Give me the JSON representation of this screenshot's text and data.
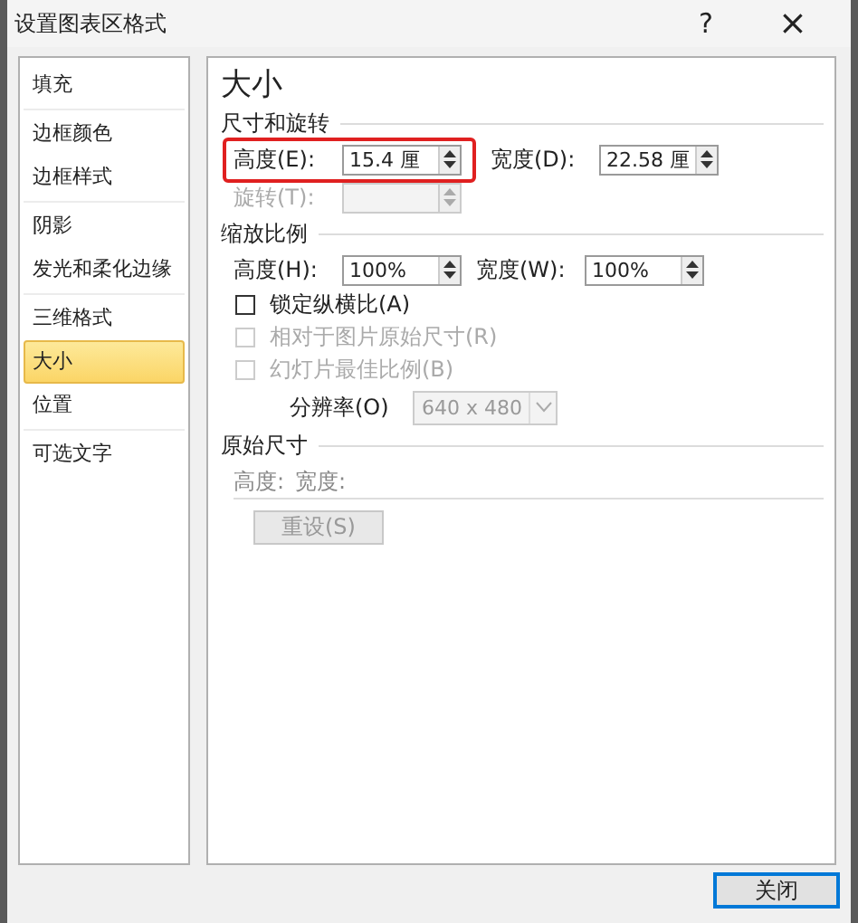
{
  "window": {
    "title": "设置图表区格式",
    "help": "?",
    "close": "×"
  },
  "sidebar": {
    "items": [
      {
        "label": "填充",
        "selected": false,
        "separator_after": true
      },
      {
        "label": "边框颜色",
        "selected": false,
        "separator_after": false
      },
      {
        "label": "边框样式",
        "selected": false,
        "separator_after": true
      },
      {
        "label": "阴影",
        "selected": false,
        "separator_after": false
      },
      {
        "label": "发光和柔化边缘",
        "selected": false,
        "separator_after": true
      },
      {
        "label": "三维格式",
        "selected": false,
        "separator_after": false
      },
      {
        "label": "大小",
        "selected": true,
        "separator_after": false
      },
      {
        "label": "位置",
        "selected": false,
        "separator_after": true
      },
      {
        "label": "可选文字",
        "selected": false,
        "separator_after": false
      }
    ]
  },
  "panel": {
    "title": "大小",
    "size_rotate": {
      "title": "尺寸和旋转",
      "height": {
        "label": "高度(E):",
        "value": "15.4 厘",
        "disabled": false,
        "highlighted": true
      },
      "width": {
        "label": "宽度(D):",
        "value": "22.58 厘",
        "disabled": false
      },
      "rotation": {
        "label": "旋转(T):",
        "disabled": true
      }
    },
    "scale": {
      "title": "缩放比例",
      "height": {
        "label": "高度(H):",
        "value": "100%",
        "disabled": false
      },
      "width": {
        "label": "宽度(W):",
        "value": "100%",
        "disabled": false
      },
      "checkboxes": [
        {
          "label": "锁定纵横比(A)",
          "checked": false,
          "disabled": false
        },
        {
          "label": "相对于图片原始尺寸(R)",
          "checked": false,
          "disabled": true
        },
        {
          "label": "幻灯片最佳比例(B)",
          "checked": false,
          "disabled": true
        }
      ],
      "resolution": {
        "label": "分辨率(O)",
        "value": "640 x 480",
        "disabled": true
      }
    },
    "original": {
      "title": "原始尺寸",
      "height_label": "高度:",
      "width_label": "宽度:",
      "reset_button": {
        "label": "重设(S)",
        "disabled": true
      }
    }
  },
  "buttons": [
    {
      "label": "关闭",
      "focused": true
    }
  ]
}
